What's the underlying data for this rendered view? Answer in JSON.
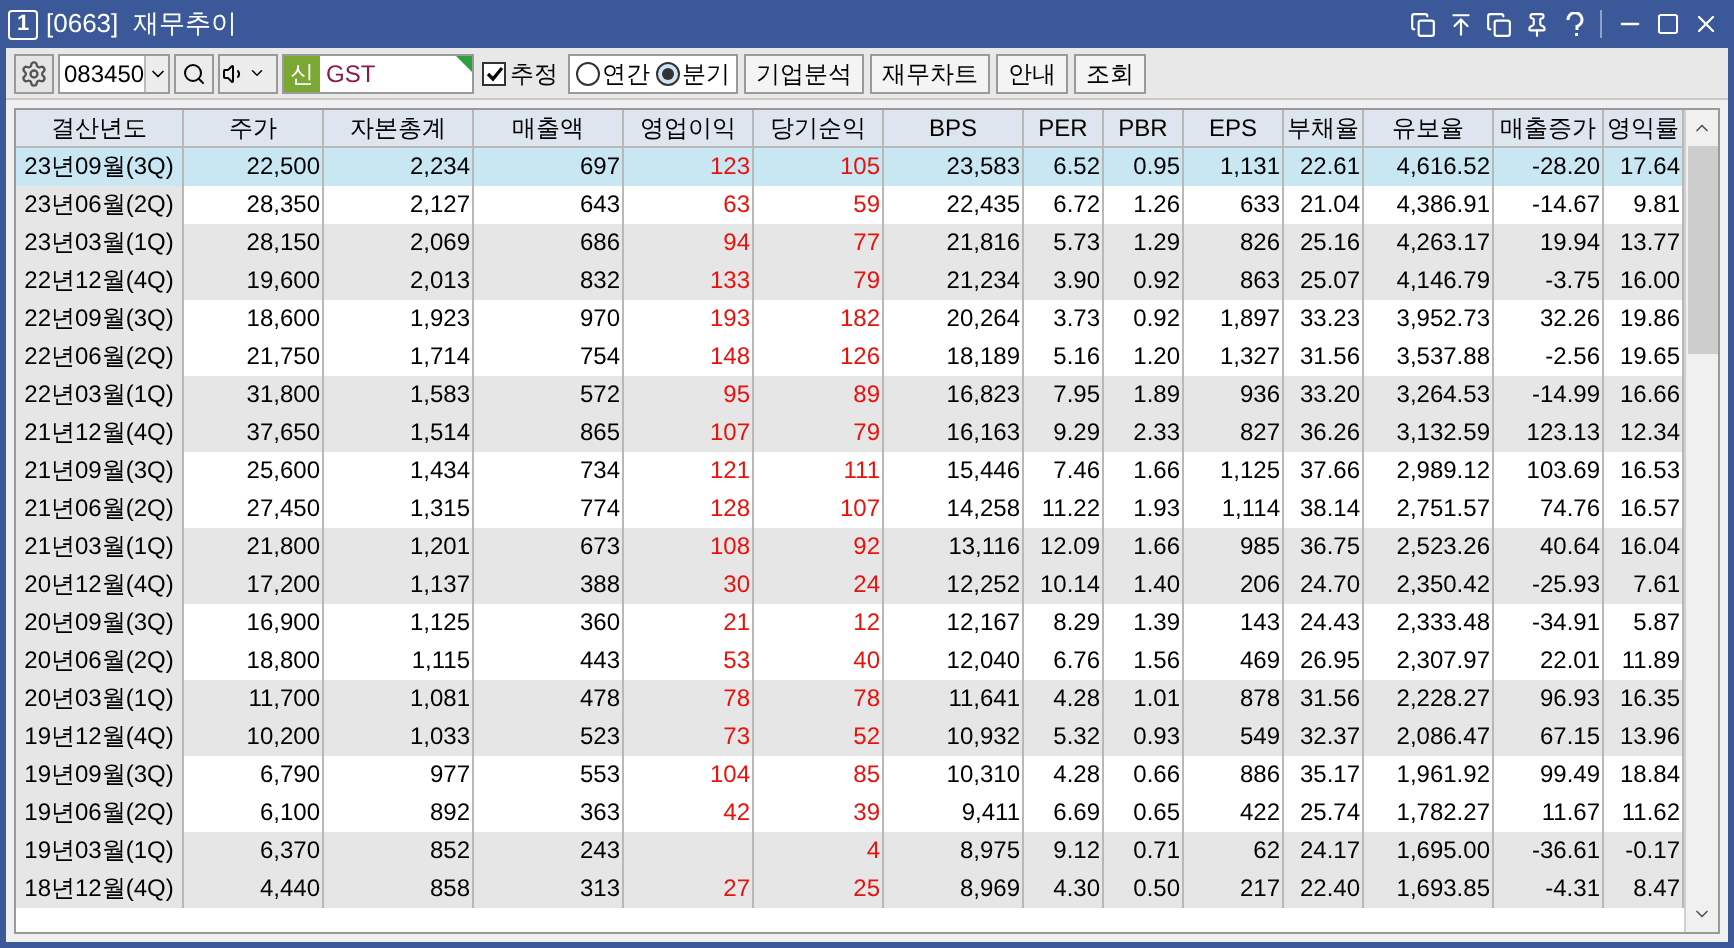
{
  "window": {
    "badge": "1",
    "title": "[0663]  재무추이"
  },
  "toolbar": {
    "code": "083450",
    "new_badge": "신",
    "name": "GST",
    "estimate": {
      "label": "추정",
      "checked": true
    },
    "period": [
      {
        "label": "연간",
        "selected": false
      },
      {
        "label": "분기",
        "selected": true
      }
    ],
    "buttons": [
      "기업분석",
      "재무차트",
      "안내",
      "조회"
    ]
  },
  "table": {
    "columns": [
      {
        "label": "결산년도",
        "kind": "period"
      },
      {
        "label": "주가",
        "kind": "plain"
      },
      {
        "label": "자본총계",
        "kind": "plain"
      },
      {
        "label": "매출액",
        "kind": "plain"
      },
      {
        "label": "영업이익",
        "kind": "accent"
      },
      {
        "label": "당기순익",
        "kind": "accent"
      },
      {
        "label": "BPS",
        "kind": "plain"
      },
      {
        "label": "PER",
        "kind": "plain"
      },
      {
        "label": "PBR",
        "kind": "plain"
      },
      {
        "label": "EPS",
        "kind": "plain"
      },
      {
        "label": "부채율",
        "kind": "plain"
      },
      {
        "label": "유보율",
        "kind": "plain"
      },
      {
        "label": "매출증가",
        "kind": "plain"
      },
      {
        "label": "영익률",
        "kind": "plain"
      }
    ],
    "rows": [
      {
        "selected": true,
        "cells": [
          "23년09월(3Q)",
          "22,500",
          "2,234",
          "697",
          "123",
          "105",
          "23,583",
          "6.52",
          "0.95",
          "1,131",
          "22.61",
          "4,616.52",
          "-28.20",
          "17.64"
        ]
      },
      {
        "selected": false,
        "cells": [
          "23년06월(2Q)",
          "28,350",
          "2,127",
          "643",
          "63",
          "59",
          "22,435",
          "6.72",
          "1.26",
          "633",
          "21.04",
          "4,386.91",
          "-14.67",
          "9.81"
        ]
      },
      {
        "selected": false,
        "cells": [
          "23년03월(1Q)",
          "28,150",
          "2,069",
          "686",
          "94",
          "77",
          "21,816",
          "5.73",
          "1.29",
          "826",
          "25.16",
          "4,263.17",
          "19.94",
          "13.77"
        ]
      },
      {
        "selected": false,
        "cells": [
          "22년12월(4Q)",
          "19,600",
          "2,013",
          "832",
          "133",
          "79",
          "21,234",
          "3.90",
          "0.92",
          "863",
          "25.07",
          "4,146.79",
          "-3.75",
          "16.00"
        ]
      },
      {
        "selected": false,
        "cells": [
          "22년09월(3Q)",
          "18,600",
          "1,923",
          "970",
          "193",
          "182",
          "20,264",
          "3.73",
          "0.92",
          "1,897",
          "33.23",
          "3,952.73",
          "32.26",
          "19.86"
        ]
      },
      {
        "selected": false,
        "cells": [
          "22년06월(2Q)",
          "21,750",
          "1,714",
          "754",
          "148",
          "126",
          "18,189",
          "5.16",
          "1.20",
          "1,327",
          "31.56",
          "3,537.88",
          "-2.56",
          "19.65"
        ]
      },
      {
        "selected": false,
        "cells": [
          "22년03월(1Q)",
          "31,800",
          "1,583",
          "572",
          "95",
          "89",
          "16,823",
          "7.95",
          "1.89",
          "936",
          "33.20",
          "3,264.53",
          "-14.99",
          "16.66"
        ]
      },
      {
        "selected": false,
        "cells": [
          "21년12월(4Q)",
          "37,650",
          "1,514",
          "865",
          "107",
          "79",
          "16,163",
          "9.29",
          "2.33",
          "827",
          "36.26",
          "3,132.59",
          "123.13",
          "12.34"
        ]
      },
      {
        "selected": false,
        "cells": [
          "21년09월(3Q)",
          "25,600",
          "1,434",
          "734",
          "121",
          "111",
          "15,446",
          "7.46",
          "1.66",
          "1,125",
          "37.66",
          "2,989.12",
          "103.69",
          "16.53"
        ]
      },
      {
        "selected": false,
        "cells": [
          "21년06월(2Q)",
          "27,450",
          "1,315",
          "774",
          "128",
          "107",
          "14,258",
          "11.22",
          "1.93",
          "1,114",
          "38.14",
          "2,751.57",
          "74.76",
          "16.57"
        ]
      },
      {
        "selected": false,
        "cells": [
          "21년03월(1Q)",
          "21,800",
          "1,201",
          "673",
          "108",
          "92",
          "13,116",
          "12.09",
          "1.66",
          "985",
          "36.75",
          "2,523.26",
          "40.64",
          "16.04"
        ]
      },
      {
        "selected": false,
        "cells": [
          "20년12월(4Q)",
          "17,200",
          "1,137",
          "388",
          "30",
          "24",
          "12,252",
          "10.14",
          "1.40",
          "206",
          "24.70",
          "2,350.42",
          "-25.93",
          "7.61"
        ]
      },
      {
        "selected": false,
        "cells": [
          "20년09월(3Q)",
          "16,900",
          "1,125",
          "360",
          "21",
          "12",
          "12,167",
          "8.29",
          "1.39",
          "143",
          "24.43",
          "2,333.48",
          "-34.91",
          "5.87"
        ]
      },
      {
        "selected": false,
        "cells": [
          "20년06월(2Q)",
          "18,800",
          "1,115",
          "443",
          "53",
          "40",
          "12,040",
          "6.76",
          "1.56",
          "469",
          "26.95",
          "2,307.97",
          "22.01",
          "11.89"
        ]
      },
      {
        "selected": false,
        "cells": [
          "20년03월(1Q)",
          "11,700",
          "1,081",
          "478",
          "78",
          "78",
          "11,641",
          "4.28",
          "1.01",
          "878",
          "31.56",
          "2,228.27",
          "96.93",
          "16.35"
        ]
      },
      {
        "selected": false,
        "cells": [
          "19년12월(4Q)",
          "10,200",
          "1,033",
          "523",
          "73",
          "52",
          "10,932",
          "5.32",
          "0.93",
          "549",
          "32.37",
          "2,086.47",
          "67.15",
          "13.96"
        ]
      },
      {
        "selected": false,
        "cells": [
          "19년09월(3Q)",
          "6,790",
          "977",
          "553",
          "104",
          "85",
          "10,310",
          "4.28",
          "0.66",
          "886",
          "35.17",
          "1,961.92",
          "99.49",
          "18.84"
        ]
      },
      {
        "selected": false,
        "cells": [
          "19년06월(2Q)",
          "6,100",
          "892",
          "363",
          "42",
          "39",
          "9,411",
          "6.69",
          "0.65",
          "422",
          "25.74",
          "1,782.27",
          "11.67",
          "11.62"
        ]
      },
      {
        "selected": false,
        "cells": [
          "19년03월(1Q)",
          "6,370",
          "852",
          "243",
          null,
          "4",
          "8,975",
          "9.12",
          "0.71",
          "62",
          "24.17",
          "1,695.00",
          "-36.61",
          "-0.17"
        ]
      },
      {
        "selected": false,
        "cells": [
          "18년12월(4Q)",
          "4,440",
          "858",
          "313",
          "27",
          "25",
          "8,969",
          "4.30",
          "0.50",
          "217",
          "22.40",
          "1,693.85",
          "-4.31",
          "8.47"
        ]
      }
    ]
  }
}
